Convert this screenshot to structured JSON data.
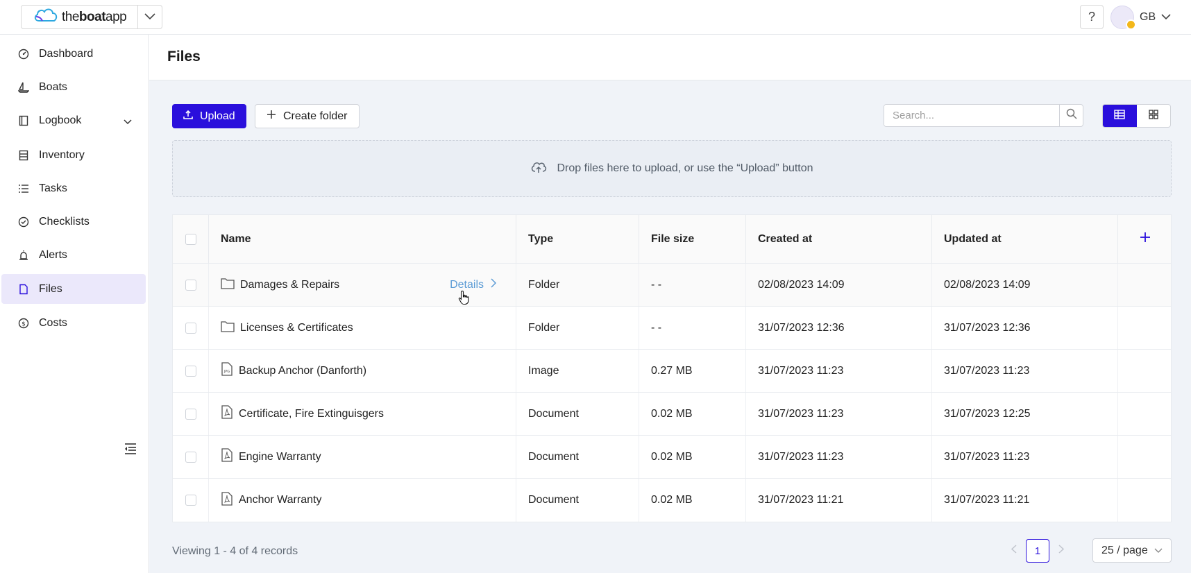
{
  "brand": {
    "prefix": "the",
    "bold": "boat",
    "suffix": "app",
    "logo_icon": "cloud-icon"
  },
  "header": {
    "help_label": "?",
    "user_initials": "GB"
  },
  "sidebar": {
    "items": [
      {
        "label": "Dashboard",
        "icon": "dashboard-icon"
      },
      {
        "label": "Boats",
        "icon": "sailboat-icon"
      },
      {
        "label": "Logbook",
        "icon": "book-icon"
      },
      {
        "label": "Inventory",
        "icon": "inventory-icon"
      },
      {
        "label": "Tasks",
        "icon": "list-icon"
      },
      {
        "label": "Checklists",
        "icon": "check-circle-icon"
      },
      {
        "label": "Alerts",
        "icon": "alarm-icon"
      },
      {
        "label": "Files",
        "icon": "file-icon",
        "active": true
      },
      {
        "label": "Costs",
        "icon": "dollar-icon"
      }
    ]
  },
  "page": {
    "title": "Files"
  },
  "toolbar": {
    "upload_label": "Upload",
    "create_folder_label": "Create folder",
    "search_placeholder": "Search..."
  },
  "dropzone": {
    "text": "Drop files here to upload, or use the “Upload” button"
  },
  "table": {
    "headers": {
      "name": "Name",
      "type": "Type",
      "size": "File size",
      "created": "Created at",
      "updated": "Updated at"
    },
    "details_label": "Details",
    "rows": [
      {
        "name": "Damages & Repairs",
        "kind": "folder",
        "type": "Folder",
        "size": "- -",
        "created": "02/08/2023 14:09",
        "updated": "02/08/2023 14:09"
      },
      {
        "name": "Licenses & Certificates",
        "kind": "folder",
        "type": "Folder",
        "size": "- -",
        "created": "31/07/2023 12:36",
        "updated": "31/07/2023 12:36"
      },
      {
        "name": "Backup Anchor (Danforth)",
        "kind": "image",
        "type": "Image",
        "size": "0.27 MB",
        "created": "31/07/2023 11:23",
        "updated": "31/07/2023 11:23"
      },
      {
        "name": "Certificate, Fire Extinguisgers",
        "kind": "pdf",
        "type": "Document",
        "size": "0.02 MB",
        "created": "31/07/2023 11:23",
        "updated": "31/07/2023 12:25"
      },
      {
        "name": "Engine Warranty",
        "kind": "pdf",
        "type": "Document",
        "size": "0.02 MB",
        "created": "31/07/2023 11:23",
        "updated": "31/07/2023 11:23"
      },
      {
        "name": "Anchor Warranty",
        "kind": "pdf",
        "type": "Document",
        "size": "0.02 MB",
        "created": "31/07/2023 11:21",
        "updated": "31/07/2023 11:21"
      }
    ]
  },
  "footer": {
    "viewing": "Viewing 1 - 4 of 4 records",
    "current_page": "1",
    "page_size": "25 / page"
  },
  "colors": {
    "accent": "#2a0fdc",
    "active_nav_bg": "#ebe8fb",
    "link": "#5b9bd5"
  }
}
